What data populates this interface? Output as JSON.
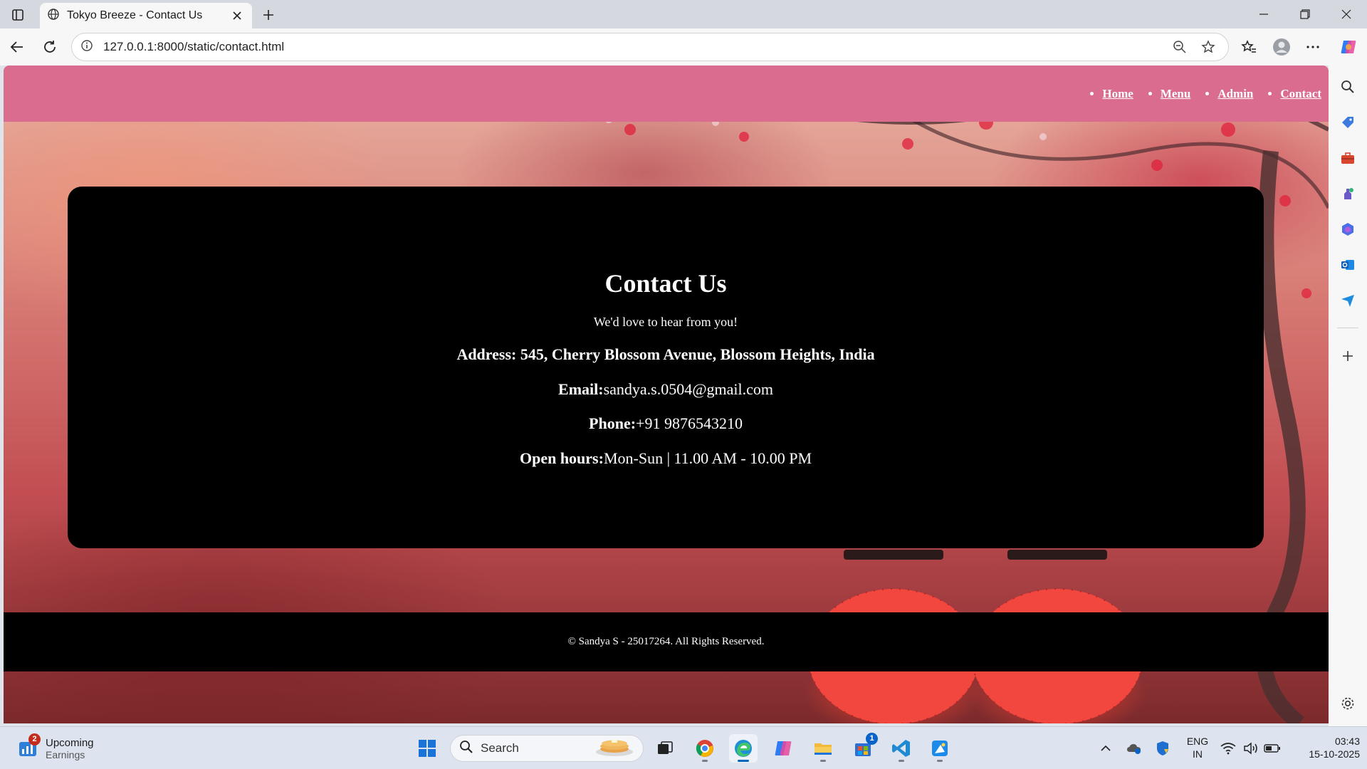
{
  "browser": {
    "tab_title": "Tokyo Breeze - Contact Us",
    "url": "127.0.0.1:8000/static/contact.html"
  },
  "site": {
    "nav": [
      "Home",
      "Menu",
      "Admin",
      "Contact"
    ],
    "contact": {
      "title": "Contact Us",
      "subtitle": "We'd love to hear from you!",
      "address": "Address: 545, Cherry Blossom Avenue, Blossom Heights, India",
      "email_label": "Email:",
      "email_value": "sandya.s.0504@gmail.com",
      "phone_label": "Phone:",
      "phone_value": "+91 9876543210",
      "hours_label": "Open hours:",
      "hours_value": "Mon-Sun | 11.00 AM - 10.00 PM"
    },
    "footer": "© Sandya S - 25017264. All Rights Reserved."
  },
  "taskbar": {
    "widget_badge": "2",
    "widget_title": "Upcoming",
    "widget_subtitle": "Earnings",
    "search_placeholder": "Search",
    "store_badge": "1",
    "language_line1": "ENG",
    "language_line2": "IN",
    "time": "03:43",
    "date": "15-10-2025"
  }
}
